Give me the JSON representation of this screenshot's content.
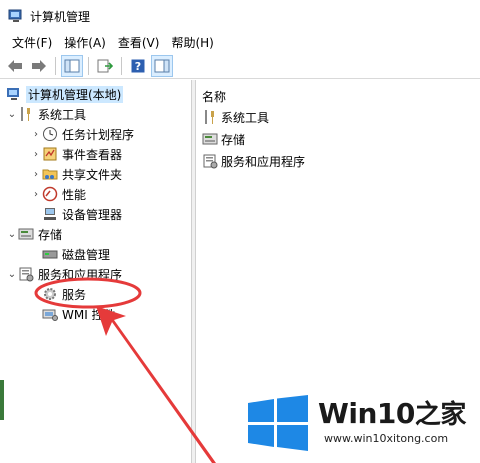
{
  "window": {
    "title": "计算机管理"
  },
  "menu": [
    "文件(F)",
    "操作(A)",
    "查看(V)",
    "帮助(H)"
  ],
  "tree": {
    "root": "计算机管理(本地)",
    "system_tools": "系统工具",
    "task_scheduler": "任务计划程序",
    "event_viewer": "事件查看器",
    "shared_folders": "共享文件夹",
    "performance": "性能",
    "device_manager": "设备管理器",
    "storage": "存储",
    "disk_management": "磁盘管理",
    "services_apps": "服务和应用程序",
    "services": "服务",
    "wmi": "WMI 控件"
  },
  "right": {
    "column_name": "名称",
    "items": [
      "系统工具",
      "存储",
      "服务和应用程序"
    ]
  },
  "watermark": {
    "brand": "Win10",
    "brand_zh": "之家",
    "url": "www.win10xitong.com"
  },
  "colors": {
    "selection": "#cce8ff",
    "annotation": "#e53a3a",
    "logo": "#1e88e5"
  }
}
